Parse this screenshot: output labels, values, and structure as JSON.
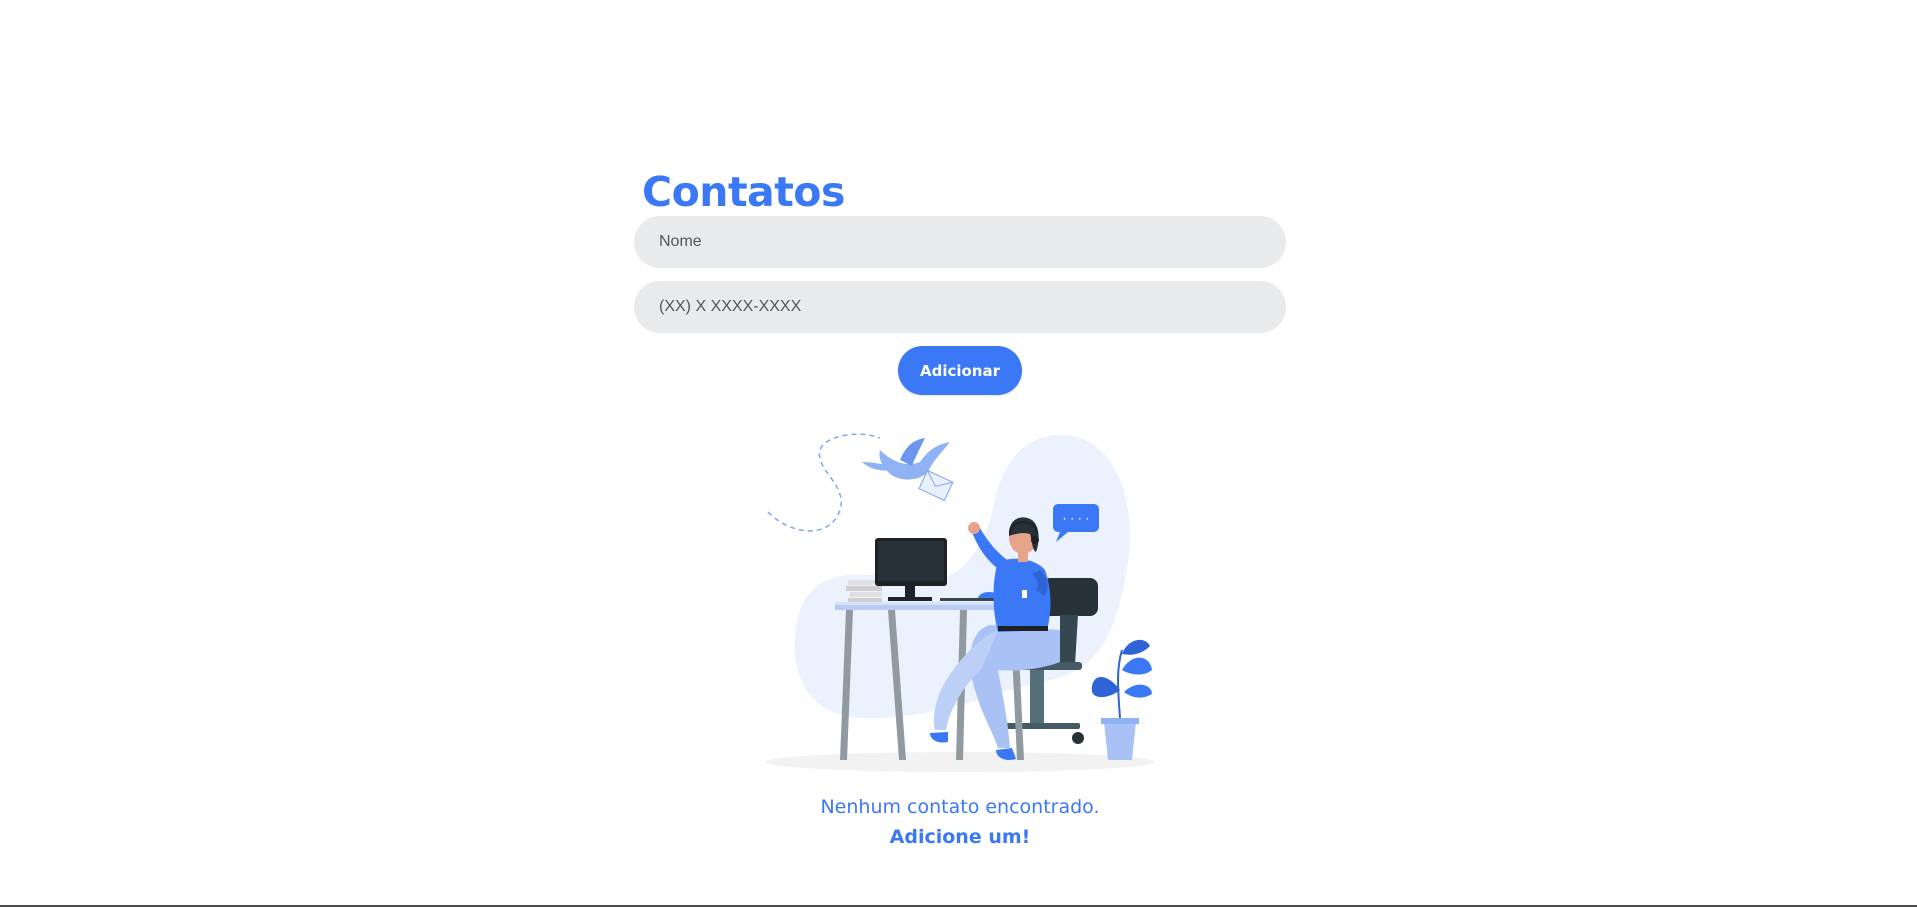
{
  "page": {
    "title": "Contatos",
    "accent_color": "#3b78f6",
    "input_bg_color": "#e8eaeb"
  },
  "form": {
    "name_placeholder": "Nome",
    "phone_placeholder": "(XX) X XXXX-XXXX",
    "add_label": "Adicionar"
  },
  "empty_state": {
    "illustration_icon": "office-worker-phone-illustration",
    "message": "Nenhum contato encontrado.",
    "cta": "Adicione um!"
  },
  "illustration": {
    "bubble_text": "· · · ·"
  }
}
